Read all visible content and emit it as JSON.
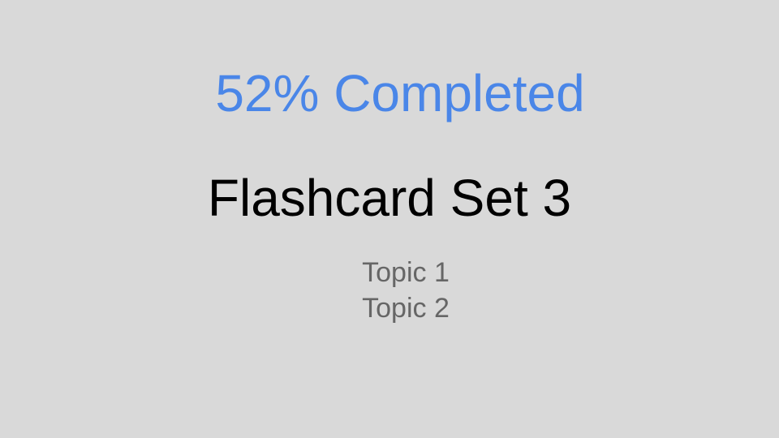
{
  "colors": {
    "background": "#d9d9d9",
    "accent": "#4a86e8",
    "title": "#000000",
    "topic": "#666666"
  },
  "progress": {
    "percent": 52,
    "label": "52% Completed"
  },
  "set": {
    "title": "Flashcard Set 3"
  },
  "topics": [
    {
      "label": "Topic 1"
    },
    {
      "label": "Topic 2"
    }
  ]
}
